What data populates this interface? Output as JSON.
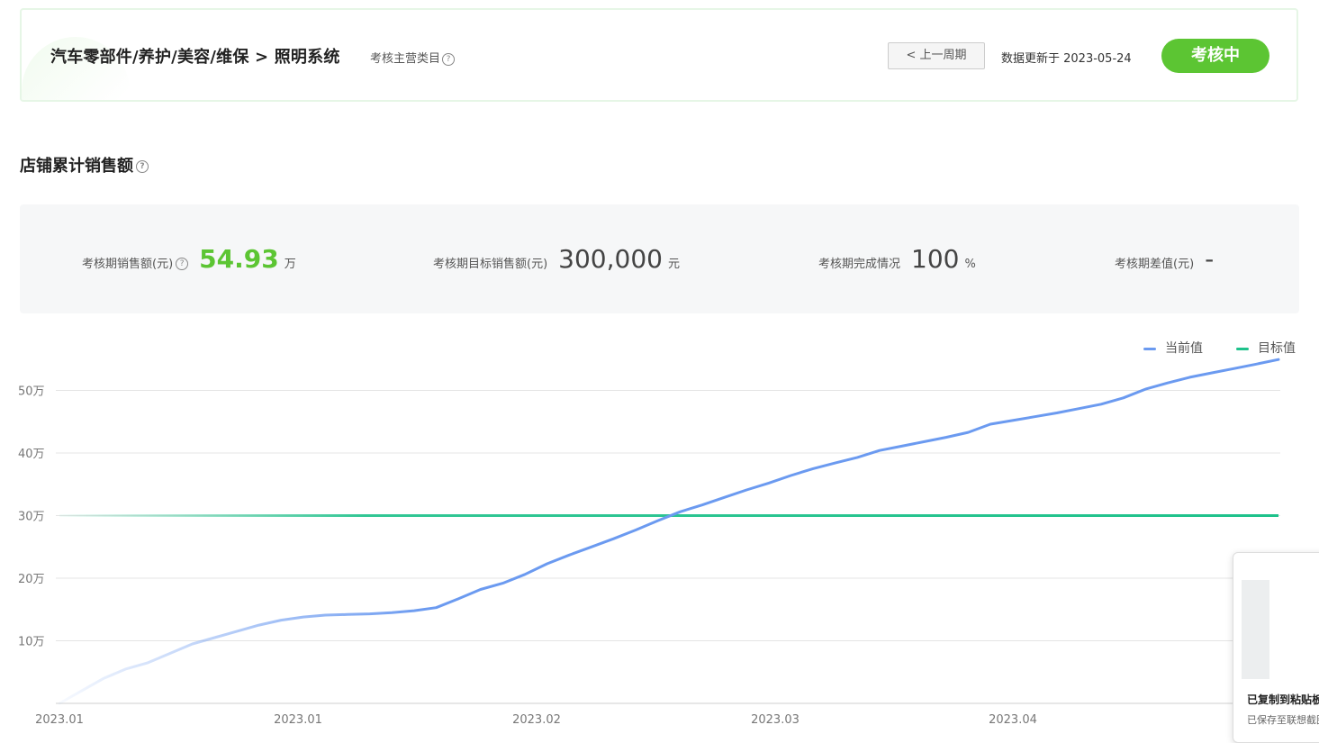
{
  "header": {
    "breadcrumb": "汽车零部件/养护/美容/维保 > 照明系统",
    "category_label": "考核主营类目",
    "prev_period_label": "< 上一周期",
    "updated_text": "数据更新于 2023-05-24",
    "status_label": "考核中"
  },
  "section_title": "店铺累计销售额",
  "metrics": [
    {
      "label": "考核期销售额(元)",
      "value": "54.93",
      "unit": "万",
      "has_help": true
    },
    {
      "label": "考核期目标销售额(元)",
      "value": "300,000",
      "unit": "元"
    },
    {
      "label": "考核期完成情况",
      "value": "100",
      "unit": "%"
    },
    {
      "label": "考核期差值(元)",
      "value": "-",
      "unit": ""
    }
  ],
  "toast": {
    "title": "已复制到粘贴板",
    "subtitle": "已保存至联想截图"
  },
  "colors": {
    "accent_green": "#5cc533",
    "current_line": "#6b9af0",
    "target_line": "#1ec28b"
  },
  "chart_data": {
    "type": "line",
    "x_tick_labels": [
      "2023.01",
      "2023.01",
      "2023.02",
      "2023.03",
      "2023.04"
    ],
    "y_tick_labels": [
      "10万",
      "20万",
      "30万",
      "40万",
      "50万"
    ],
    "y_ticks": [
      10,
      20,
      30,
      40,
      50
    ],
    "ylim": [
      0,
      55
    ],
    "grid": true,
    "legend_position": "top-right",
    "series": [
      {
        "name": "当前值",
        "color": "#6b9af0",
        "values": [
          0,
          2,
          4,
          5.5,
          6.5,
          8,
          9.5,
          10.5,
          11.5,
          12.5,
          13.3,
          13.8,
          14.1,
          14.2,
          14.3,
          14.5,
          14.8,
          15.3,
          16.7,
          18.2,
          19.2,
          20.6,
          22.3,
          23.7,
          25.0,
          26.3,
          27.7,
          29.2,
          30.6,
          31.7,
          32.9,
          34.1,
          35.2,
          36.4,
          37.5,
          38.4,
          39.3,
          40.4,
          41.1,
          41.8,
          42.5,
          43.3,
          44.6,
          45.2,
          45.8,
          46.4,
          47.1,
          47.8,
          48.8,
          50.2,
          51.2,
          52.1,
          52.8,
          53.5,
          54.2,
          54.93
        ]
      },
      {
        "name": "目标值",
        "color": "#1ec28b",
        "values": [
          30,
          30
        ]
      }
    ]
  }
}
